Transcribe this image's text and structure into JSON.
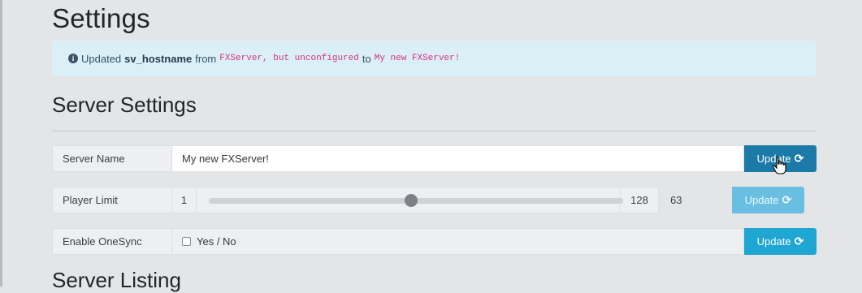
{
  "page": {
    "title": "Settings"
  },
  "alert": {
    "prefix": "Updated",
    "key": "sv_hostname",
    "from_word": "from",
    "old_value": "FXServer, but unconfigured",
    "to_word": "to",
    "new_value": "My new FXServer!"
  },
  "server_settings": {
    "heading": "Server Settings",
    "server_name": {
      "label": "Server Name",
      "value": "My new FXServer!",
      "button": "Update"
    },
    "player_limit": {
      "label": "Player Limit",
      "min": "1",
      "max": "128",
      "value": "63",
      "button": "Update",
      "button_state": "disabled"
    },
    "onesync": {
      "label": "Enable OneSync",
      "checkbox_label": "Yes / No",
      "checked": false,
      "button": "Update"
    }
  },
  "server_listing": {
    "heading": "Server Listing"
  },
  "icons": {
    "alert": "info-circle-icon",
    "update": "refresh-icon"
  },
  "colors": {
    "update_active": "#1b7aa8",
    "update_primary": "#1fa6d2",
    "update_disabled": "#68bfe1"
  }
}
